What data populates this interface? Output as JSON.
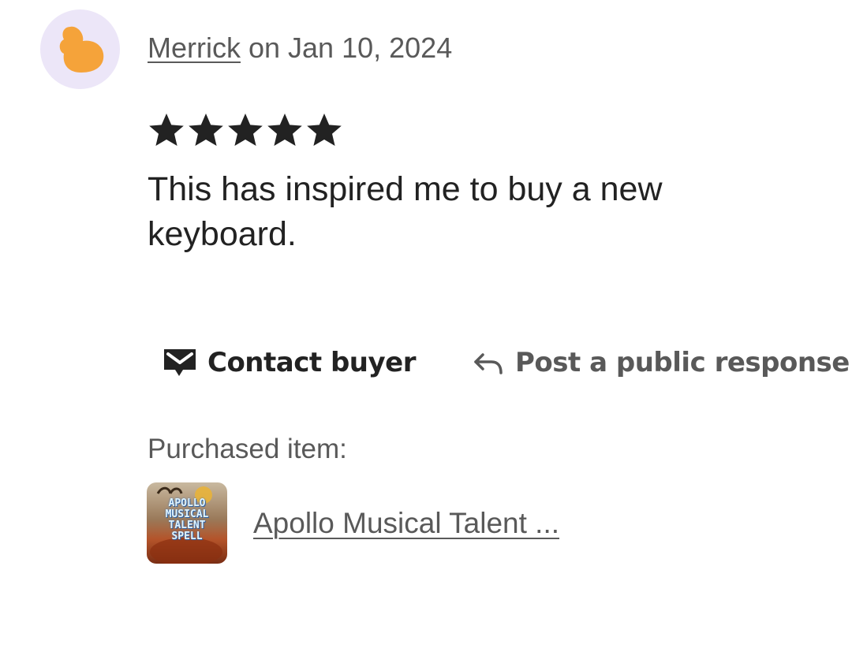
{
  "review": {
    "reviewer_name": "Merrick",
    "date_text": " on Jan 10, 2024",
    "rating": 5,
    "rating_max": 5,
    "text": "This has inspired me to buy a new keyboard.",
    "avatar_icon": "orange-blob-avatar-icon"
  },
  "actions": {
    "contact_label": "Contact buyer",
    "contact_icon": "mail-icon",
    "respond_label": "Post a public response",
    "respond_icon": "reply-arrow-icon"
  },
  "purchased": {
    "label": "Purchased item:",
    "item_title": "Apollo Musical Talent ...",
    "thumbnail_lines": [
      "APOLLO",
      "MUSICAL",
      "TALENT",
      "SPELL"
    ]
  },
  "colors": {
    "avatar_bg": "#ece6f8",
    "avatar_fg": "#f5a33a",
    "text_primary": "#222222",
    "text_secondary": "#595959"
  }
}
